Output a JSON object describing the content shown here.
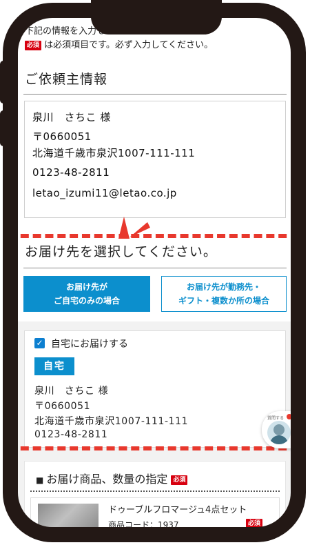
{
  "intro": {
    "line1": "下記の情報を入力もしくは、ご選択ください。",
    "required_badge": "必須",
    "line2": "は必須項目です。必ず入力してください。"
  },
  "client_section": {
    "title": "ご依頼主情報",
    "name": "泉川　さちこ 様",
    "postal": "〒0660051",
    "address": "北海道千歳市泉沢1007-111-111",
    "phone": "0123-48-2811",
    "email": "letao_izumi11@letao.co.jp"
  },
  "destination_section": {
    "title": "お届け先を選択してください。",
    "tab_home": "お届け先が\nご自宅のみの場合",
    "tab_other": "お届け先が勤務先・\nギフト・複数か所の場合"
  },
  "home_delivery": {
    "checkbox_label": "自宅にお届けする",
    "checked": true,
    "tag": "自宅",
    "name": "泉川　さちこ 様",
    "postal": "〒0660051",
    "address": "北海道千歳市泉沢1007-111-111",
    "phone": "0123-48-2811"
  },
  "chat": {
    "label": "質問する"
  },
  "products": {
    "title": "お届け商品、数量の指定",
    "required_badge": "必須",
    "item_name": "ドゥーブルフロマージュ4点セット",
    "item_code": "商品コード：1937",
    "item_required_badge": "必須"
  },
  "colors": {
    "accent_blue": "#0c8fcd",
    "required_red": "#d7000f",
    "highlight_red": "#e8382d",
    "frame": "#231815"
  }
}
